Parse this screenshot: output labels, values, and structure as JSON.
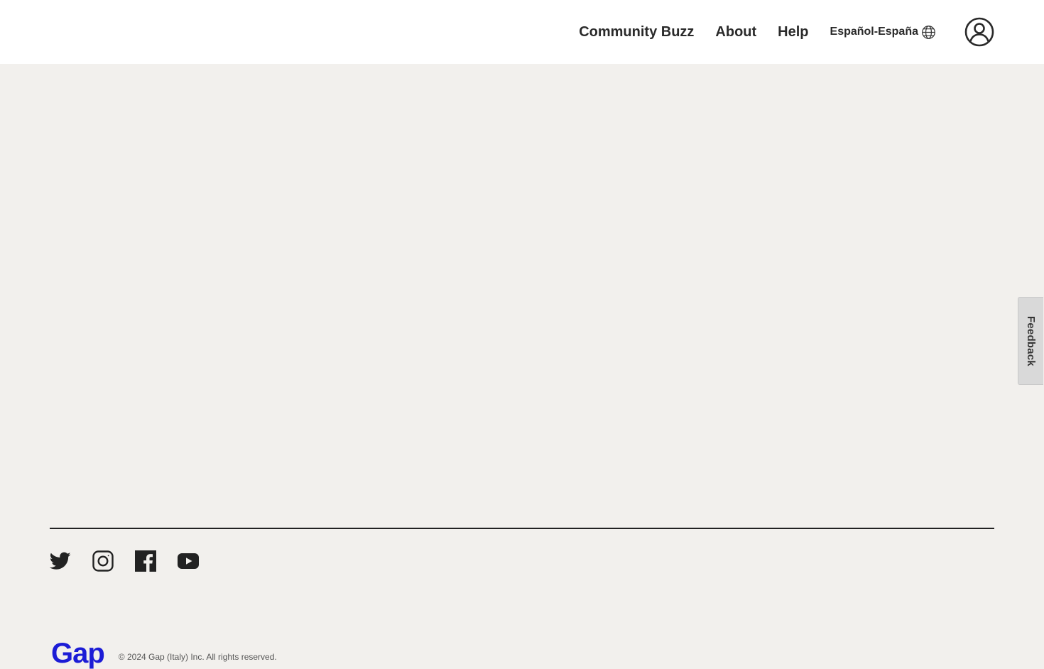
{
  "header": {
    "nav": [
      {
        "label": "Community Buzz"
      },
      {
        "label": "About"
      },
      {
        "label": "Help"
      }
    ],
    "language": {
      "label": "Español-España",
      "icon": "globe-icon"
    },
    "account": {
      "icon": "account-icon"
    }
  },
  "feedback": {
    "label": "Feedback"
  },
  "footer": {
    "social": [
      {
        "icon": "twitter-icon"
      },
      {
        "icon": "instagram-icon"
      },
      {
        "icon": "facebook-icon"
      },
      {
        "icon": "youtube-icon"
      }
    ],
    "brand": {
      "logo_text": "Gap"
    },
    "copyright": "© 2024 Gap (Italy) Inc. All rights reserved."
  },
  "colors": {
    "page_background": "#f2f0ed",
    "header_background": "#ffffff",
    "text": "#222222",
    "brand_blue": "#1c1cd6",
    "feedback_tab": "#d9d9d9"
  }
}
